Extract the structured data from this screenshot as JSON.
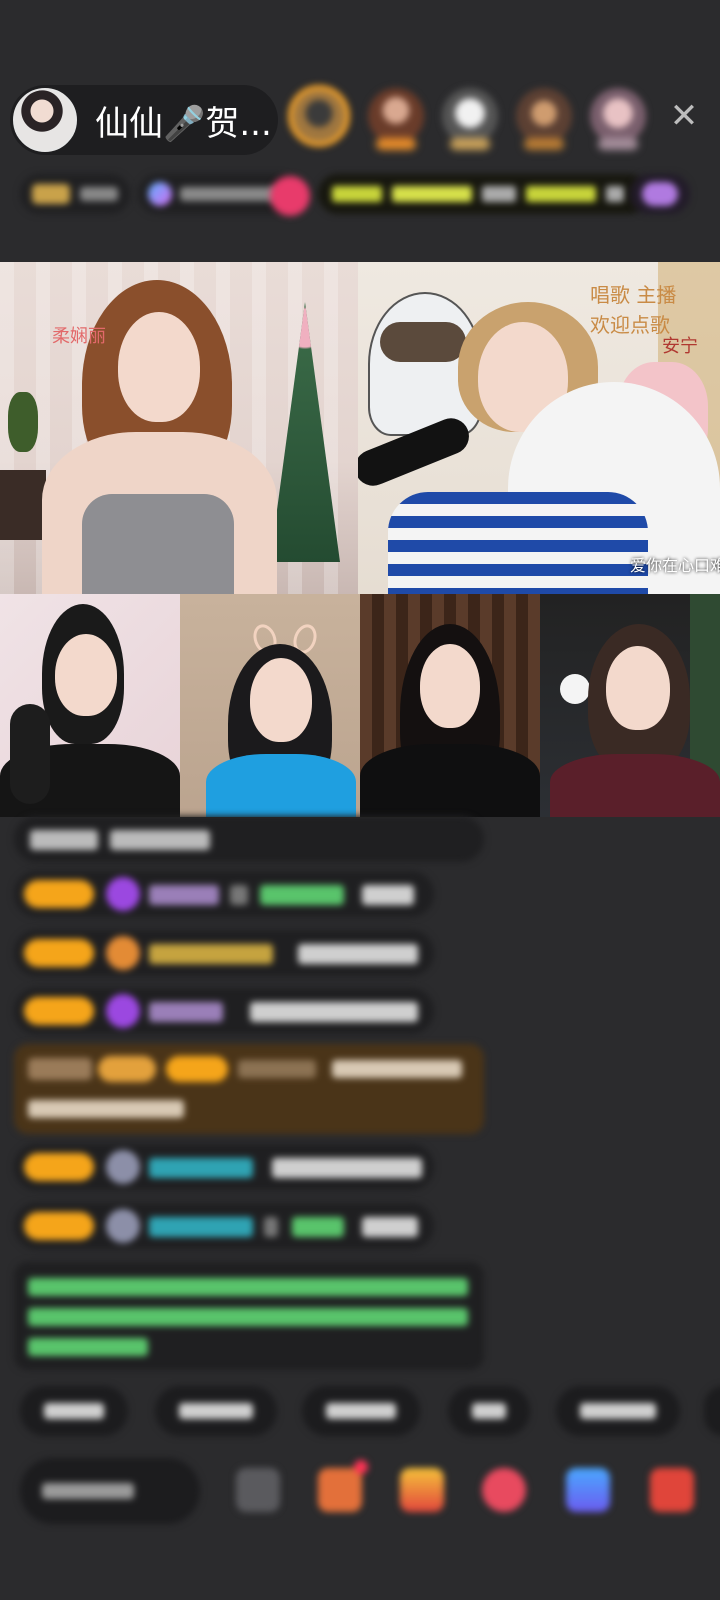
{
  "header": {
    "host_name": "仙仙🎤贺...",
    "close_symbol": "✕"
  },
  "video": {
    "tile1_watermark": "柔娴丽",
    "tile2_caption_right": "唱歌 主播\n欢迎点歌",
    "tile2_subtitle": "爱你在心口难开",
    "tile2_side_text": "安宁"
  },
  "colors": {
    "badge_orange": "#f5a51a",
    "purple_heart": "#9b48e0",
    "green_text": "#59c46b",
    "teal_text": "#2fa3b3",
    "gold_text": "#e0a23a",
    "system_notice_bg": "#4a3418"
  },
  "icons": [
    "close-icon",
    "diamond-icon",
    "bell-icon",
    "gift-box-icon",
    "package-icon",
    "red-heart-icon",
    "blue-game-icon",
    "red-gift-icon",
    "grid-icon"
  ]
}
